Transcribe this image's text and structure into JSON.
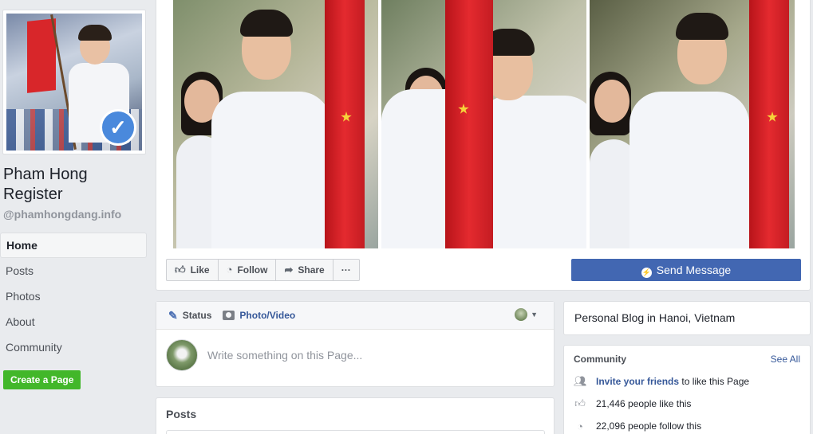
{
  "page": {
    "name": "Pham Hong Register",
    "handle": "@phamhongdang.info"
  },
  "nav": {
    "items": [
      {
        "label": "Home"
      },
      {
        "label": "Posts"
      },
      {
        "label": "Photos"
      },
      {
        "label": "About"
      },
      {
        "label": "Community"
      }
    ],
    "create_page": "Create a Page"
  },
  "actions": {
    "like": "Like",
    "follow": "Follow",
    "share": "Share",
    "more": "···",
    "send_message": "Send Message"
  },
  "composer": {
    "status_tab": "Status",
    "photo_tab": "Photo/Video",
    "placeholder": "Write something on this Page..."
  },
  "posts": {
    "title": "Posts"
  },
  "about": {
    "description": "Personal Blog in Hanoi, Vietnam"
  },
  "community": {
    "title": "Community",
    "see_all": "See All",
    "invite_link": "Invite your friends",
    "invite_rest": " to like this Page",
    "likes": "21,446 people like this",
    "follows": "22,096 people follow this"
  },
  "colors": {
    "page_bg": "#e9ebee",
    "brand_blue": "#4267b2",
    "link_blue": "#365899",
    "create_green": "#42b72a"
  },
  "icons": [
    "verified-badge-icon",
    "like-icon",
    "follow-icon",
    "share-icon",
    "messenger-icon",
    "pencil-icon",
    "camera-icon",
    "caret-down-icon",
    "people-icon",
    "thumbs-up-icon",
    "rss-icon"
  ]
}
